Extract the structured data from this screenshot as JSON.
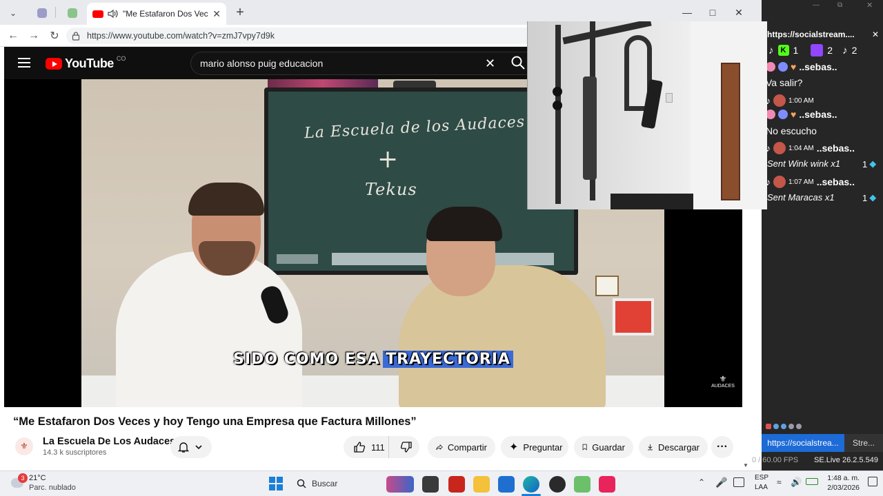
{
  "browser": {
    "active_tab_title": "\"Me Estafaron Dos Veces y hoy Tengo una Empresa que Factura Millones\"",
    "url": "https://www.youtube.com/watch?v=zmJ7vpy7d9k"
  },
  "youtube": {
    "logo_text": "YouTube",
    "country_code": "CO",
    "search_query": "mario alonso puig educacion",
    "video": {
      "board_title": "La Escuela de los Audaces",
      "board_plus": "+",
      "board_sub": "Tekus",
      "caption_a": "SIDO COMO ESA",
      "caption_b": "TRAYECTORIA",
      "watermark": "AUDACES"
    },
    "title": "“Me Estafaron Dos Veces y hoy Tengo una Empresa que Factura Millones”",
    "channel_name": "La Escuela De Los Audaces",
    "subscribers": "14.3 k suscriptores",
    "likes": "111",
    "share_label": "Compartir",
    "ask_label": "Preguntar",
    "save_label": "Guardar",
    "download_label": "Descargar"
  },
  "chat": {
    "url": "https://socialstream....",
    "platform_counts": {
      "kick": "1",
      "twitch": "2",
      "tiktok": "2"
    },
    "messages": [
      {
        "user": "..sebas..",
        "text": "Va salir?"
      },
      {
        "time": "1:00 AM",
        "user": "..sebas..",
        "text": "No escucho"
      },
      {
        "time": "1:04 AM",
        "user": "..sebas..",
        "gift": "Sent Wink wink x1",
        "gift_count": "1"
      },
      {
        "time": "1:07 AM",
        "user": "..sebas..",
        "gift": "Sent Maracas x1",
        "gift_count": "1"
      }
    ],
    "bottom_tab_1": "https://socialstrea...",
    "bottom_tab_2": "Stre...",
    "fps": "0 / 60.00 FPS",
    "version": "SE.Live 26.2.5.549"
  },
  "taskbar": {
    "weather_temp": "21°C",
    "weather_desc": "Parc. nublado",
    "weather_badge": "3",
    "search_placeholder": "Buscar",
    "lang_1": "ESP",
    "lang_2": "LAA",
    "time": "1:48 a. m.",
    "date": "2/03/2026"
  },
  "colors": {
    "youtube_red": "#ff0000",
    "caption_highlight": "#3a6bd8",
    "taskbar_bg": "#eef0f4"
  }
}
